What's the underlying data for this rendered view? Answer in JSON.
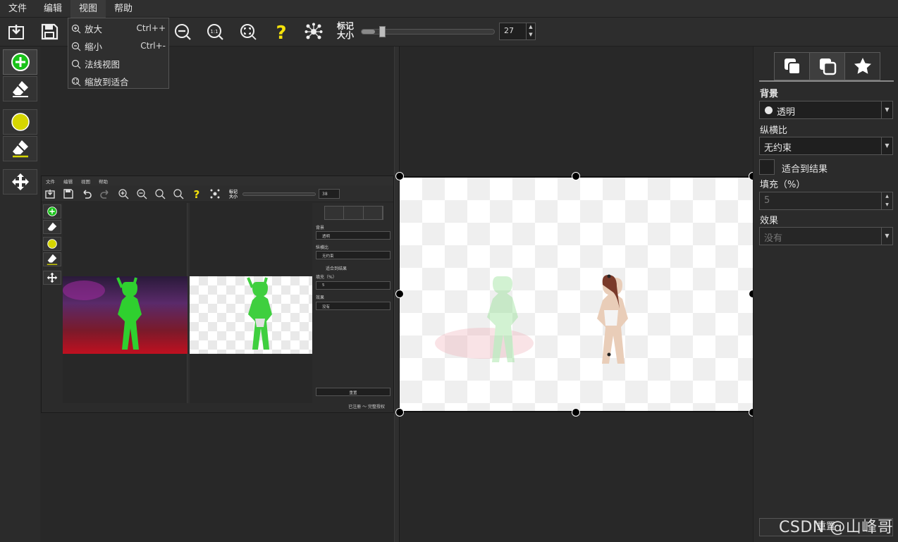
{
  "menubar": {
    "items": [
      "文件",
      "编辑",
      "视图",
      "帮助"
    ],
    "active_index": 2
  },
  "view_menu": {
    "items": [
      {
        "label": "放大",
        "shortcut": "Ctrl++",
        "icon": "zoom-in-icon"
      },
      {
        "label": "缩小",
        "shortcut": "Ctrl+-",
        "icon": "zoom-out-icon"
      },
      {
        "label": "法线视图",
        "shortcut": "",
        "icon": "zoom-actual-icon"
      },
      {
        "label": "缩放到适合",
        "shortcut": "",
        "icon": "zoom-fit-icon"
      }
    ]
  },
  "toolbar": {
    "icons": [
      "import-icon",
      "save-icon",
      "zoom-out-icon",
      "zoom-actual-icon",
      "zoom-fit-icon",
      "help-icon",
      "network-icon"
    ],
    "marker_label_line1": "标记",
    "marker_label_line2": "大小",
    "marker_size": "27",
    "marker_slider_fraction": 0.1
  },
  "left_tools": {
    "icons": [
      "add-foreground-icon",
      "eraser-icon",
      "background-marker-icon",
      "eraser-background-icon",
      "move-icon"
    ]
  },
  "embedded_screenshot": {
    "menu": [
      "文件",
      "编辑",
      "视图",
      "帮助"
    ],
    "marker_label_line1": "标记",
    "marker_label_line2": "大小",
    "marker_size": "38",
    "bg_label": "背景",
    "bg_value": "透明",
    "aspect_label": "纵横比",
    "aspect_value": "无约束",
    "fit_label": "适合到结果",
    "fill_label": "填充（%）",
    "fill_value": "5",
    "effect_label": "效果",
    "effect_value": "没有",
    "reset_label": "重置",
    "status": "已注册 ～ 完整授权"
  },
  "props": {
    "tabs": [
      "copy-layers-icon",
      "copy-outline-icon",
      "star-effects-icon"
    ],
    "active_tab": 1,
    "background_label": "背景",
    "background_value": "透明",
    "aspect_label": "纵横比",
    "aspect_value": "无约束",
    "fit_label": "适合到结果",
    "fill_label": "填充（%）",
    "fill_value": "5",
    "effect_label": "效果",
    "effect_value": "没有",
    "reset_label": "重置"
  },
  "watermark": "CSDN @山峰哥",
  "colors": {
    "accent_green": "#19c219",
    "marker_yellow": "#d6d600",
    "help_yellow": "#f5e20a"
  }
}
